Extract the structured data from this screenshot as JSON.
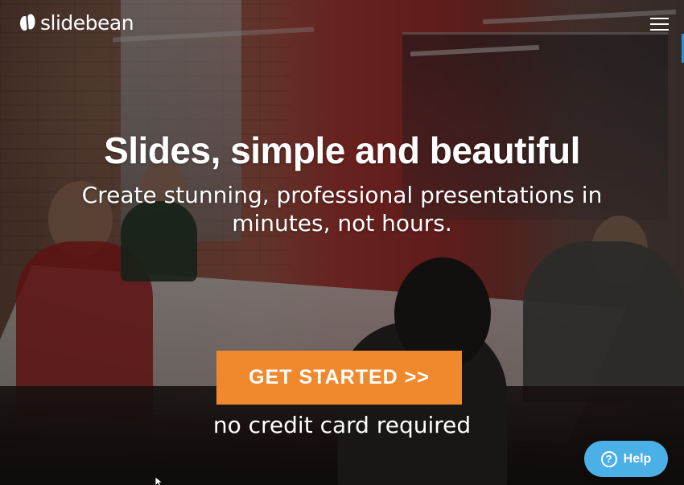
{
  "header": {
    "logo_text": "slidebean",
    "logo_icon": "slidebean-bean-icon",
    "menu_icon": "hamburger-menu-icon"
  },
  "hero": {
    "headline": "Slides, simple and beautiful",
    "subheadline": "Create stunning, professional presentations in minutes, not hours.",
    "cta_label": "GET STARTED >>",
    "cta_note": "no credit card required"
  },
  "help_widget": {
    "label": "Help",
    "icon": "question-circle-icon"
  },
  "colors": {
    "cta": "#f0892e",
    "help": "#4ab0e6",
    "text": "#ffffff"
  }
}
